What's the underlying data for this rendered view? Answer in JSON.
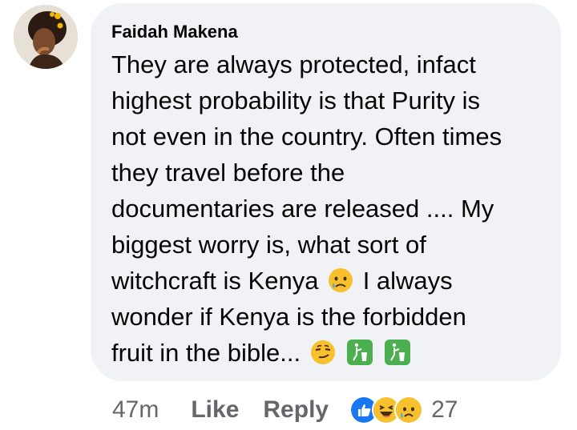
{
  "comment": {
    "author": "Faidah Makena",
    "text_lines": [
      "They are always protected, infact",
      "highest probability is that Purity is",
      "not even in the country. Often times",
      "they travel before the",
      "documentaries are released .... My",
      "biggest worry is, what sort of",
      "witchcraft is Kenya",
      "I always",
      "wonder if Kenya is the forbidden",
      "fruit in the bible..."
    ],
    "emojis": {
      "line7": "sad-tear-emoji",
      "line9": [
        "smirk-emoji",
        "litter-bin-emoji",
        "litter-bin-emoji"
      ]
    }
  },
  "actions": {
    "time": "47m",
    "like_label": "Like",
    "reply_label": "Reply",
    "reaction_icons": [
      "like-reaction-icon",
      "haha-reaction-icon",
      "sad-reaction-icon"
    ],
    "reaction_count": "27"
  },
  "colors": {
    "bubble_bg": "#f0f2f5",
    "text": "#050505",
    "meta": "#65676b",
    "like_blue": "#1877f2",
    "emoji_yellow": "#f7c12e",
    "bin_green": "#4caf50"
  }
}
